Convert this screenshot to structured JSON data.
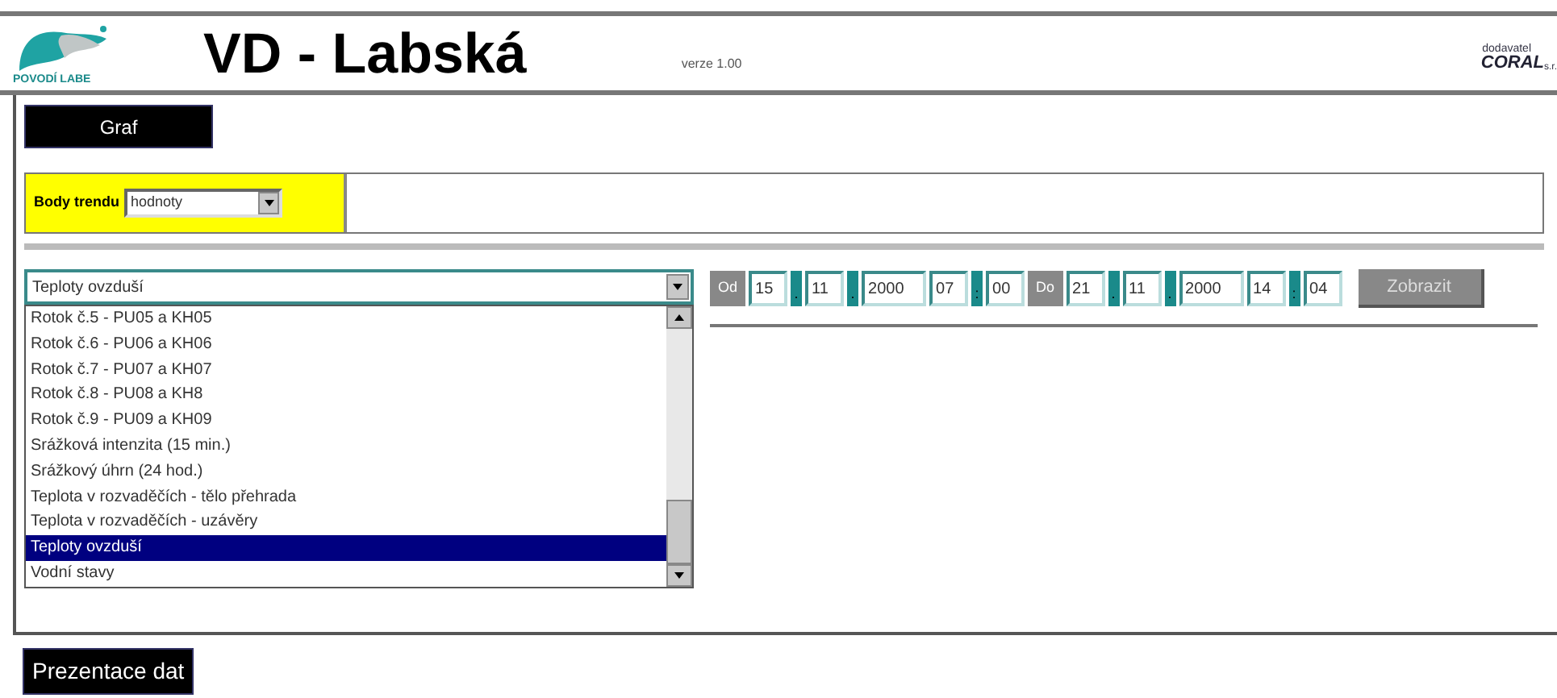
{
  "header": {
    "logo_text": "POVODÍ LABE",
    "title": "VD - Labská",
    "version": "verze 1.00",
    "supplier_label": "dodavatel",
    "supplier_name": "CORAL",
    "supplier_suffix": "s.r."
  },
  "graph_button": "Graf",
  "data_points": {
    "label": "Body trendu",
    "value": "hodnoty"
  },
  "channel_select": {
    "value": "Teploty ovzduší",
    "expanded": true,
    "options": [
      {
        "label": "Rotok č.5 - PU05 a KH05",
        "selected": false
      },
      {
        "label": "Rotok č.6 - PU06 a KH06",
        "selected": false
      },
      {
        "label": "Rotok č.7 - PU07 a KH07",
        "selected": false
      },
      {
        "label": "Rotok č.8 - PU08 a KH8",
        "selected": false
      },
      {
        "label": "Rotok č.9 - PU09 a KH09",
        "selected": false
      },
      {
        "label": "Srážková intenzita (15 min.)",
        "selected": false
      },
      {
        "label": "Srážkový úhrn (24 hod.)",
        "selected": false
      },
      {
        "label": "Teplota v rozvaděčích - tělo přehrada",
        "selected": false
      },
      {
        "label": "Teplota v rozvaděčích - uzávěry",
        "selected": false
      },
      {
        "label": "Teploty ovzduší",
        "selected": true
      },
      {
        "label": "Vodní stavy",
        "selected": false
      }
    ]
  },
  "date_range": [
    {
      "kind": "label",
      "text": "Od"
    },
    {
      "kind": "field",
      "text": "15"
    },
    {
      "kind": "sep",
      "text": "."
    },
    {
      "kind": "field",
      "text": "11"
    },
    {
      "kind": "sep",
      "text": "."
    },
    {
      "kind": "year",
      "text": "2000"
    },
    {
      "kind": "field",
      "text": "07"
    },
    {
      "kind": "sep",
      "text": ":"
    },
    {
      "kind": "field",
      "text": "00"
    },
    {
      "kind": "label",
      "text": "Do"
    },
    {
      "kind": "field",
      "text": "21"
    },
    {
      "kind": "sep",
      "text": "."
    },
    {
      "kind": "field",
      "text": "11"
    },
    {
      "kind": "sep",
      "text": "."
    },
    {
      "kind": "year",
      "text": "2000"
    },
    {
      "kind": "field",
      "text": "14"
    },
    {
      "kind": "sep",
      "text": ":"
    },
    {
      "kind": "field",
      "text": "04"
    }
  ],
  "show_button": "Zobrazit",
  "footer_label": "Prezentace dat"
}
